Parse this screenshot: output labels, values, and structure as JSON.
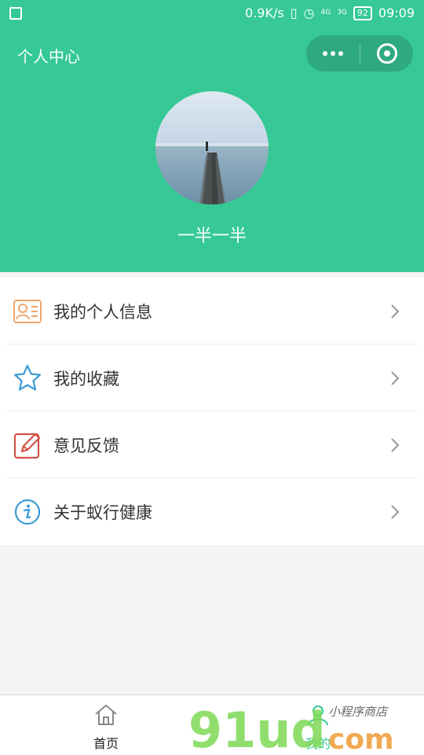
{
  "status_bar": {
    "network_speed": "0.9K/s",
    "signal1": "4G",
    "signal2": "3G",
    "battery": "92",
    "time": "09:09"
  },
  "nav": {
    "title": "个人中心"
  },
  "profile": {
    "nickname": "一半一半"
  },
  "menu": {
    "items": [
      {
        "label": "我的个人信息",
        "icon": "contact-card-icon"
      },
      {
        "label": "我的收藏",
        "icon": "star-icon"
      },
      {
        "label": "意见反馈",
        "icon": "edit-icon"
      },
      {
        "label": "关于蚁行健康",
        "icon": "info-icon"
      }
    ]
  },
  "tabbar": {
    "home_label": "首页",
    "mine_label": "我的"
  },
  "watermark": {
    "brand": "91udcom",
    "subtitle": "小程序商店"
  },
  "colors": {
    "primary": "#36c995",
    "capsule": "#2faa7e",
    "icon_orange": "#f0a66c",
    "icon_blue": "#3d9bd6",
    "icon_red": "#d35447"
  }
}
